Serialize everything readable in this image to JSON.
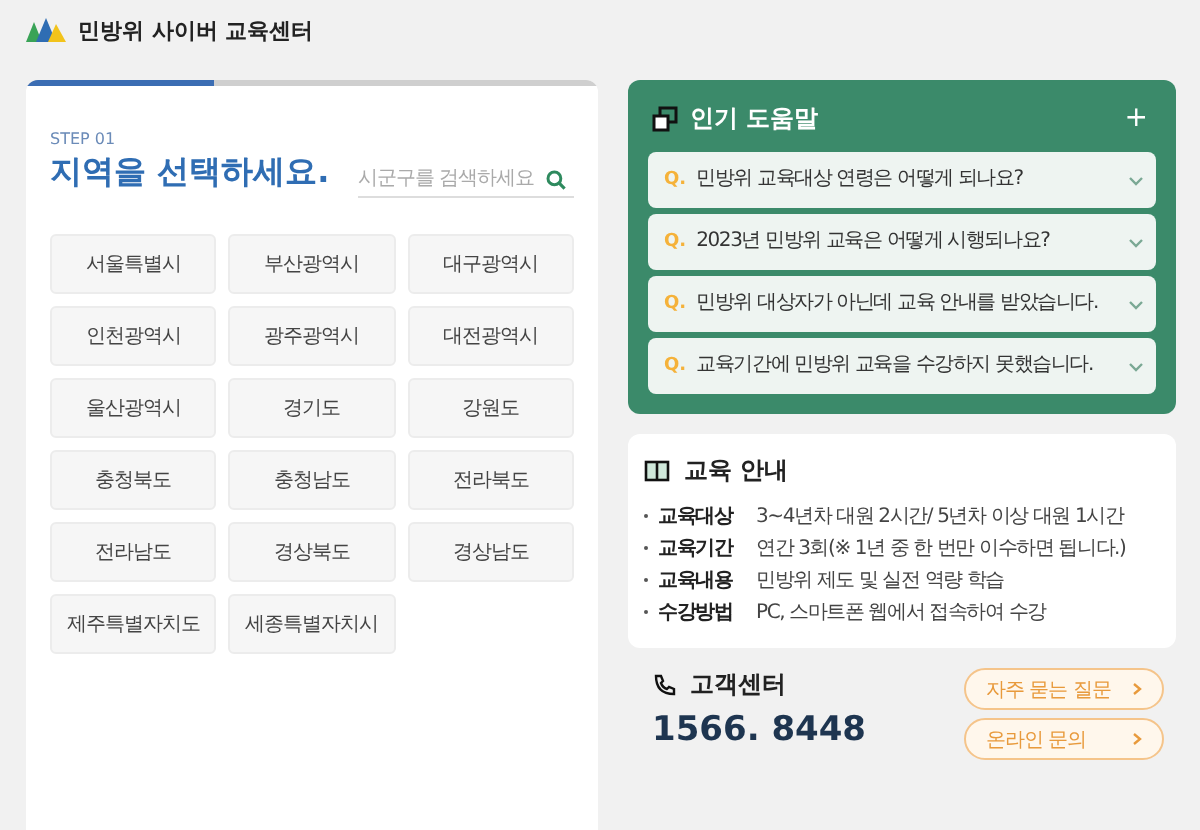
{
  "header": {
    "title": "민방위 사이버 교육센터"
  },
  "region_panel": {
    "progress": {
      "level": 0.33
    },
    "step": "STEP 01",
    "title": "지역을 선택하세요.",
    "search": {
      "placeholder": "시군구를 검색하세요"
    },
    "regions": [
      "서울특별시",
      "부산광역시",
      "대구광역시",
      "인천광역시",
      "광주광역시",
      "대전광역시",
      "울산광역시",
      "경기도",
      "강원도",
      "충청북도",
      "충청남도",
      "전라북도",
      "전라남도",
      "경상북도",
      "경상남도",
      "제주특별자치도",
      "세종특별자치시"
    ]
  },
  "faq": {
    "title": "인기 도움말",
    "add": "+",
    "items": [
      {
        "q": "Q.",
        "text": "민방위 교육대상 연령은 어떻게 되나요?",
        "expanded": false
      },
      {
        "q": "Q.",
        "text": "2023년 민방위 교육은 어떻게 시행되나요?",
        "expanded": false
      },
      {
        "q": "Q.",
        "text": "민방위 대상자가 아닌데 교육 안내를 받았습니다.",
        "expanded": false
      },
      {
        "q": "Q.",
        "text": "교육기간에 민방위 교육을 수강하지 못했습니다.",
        "expanded": false
      }
    ]
  },
  "info": {
    "title": "교육 안내",
    "rows": [
      {
        "label": "교육대상",
        "value": "3~4년차 대원 2시간/ 5년차 이상 대원 1시간"
      },
      {
        "label": "교육기간",
        "value": "연간 3회(※ 1년 중 한 번만 이수하면 됩니다.)"
      },
      {
        "label": "교육내용",
        "value": "민방위 제도 및 실전 역량 학습"
      },
      {
        "label": "수강방법",
        "value": "PC, 스마트폰 웹에서 접속하여 수강"
      }
    ]
  },
  "support": {
    "title": "고객센터",
    "phone": "1566. 8448",
    "buttons": [
      "자주 묻는 질문",
      "온라인 문의"
    ]
  }
}
